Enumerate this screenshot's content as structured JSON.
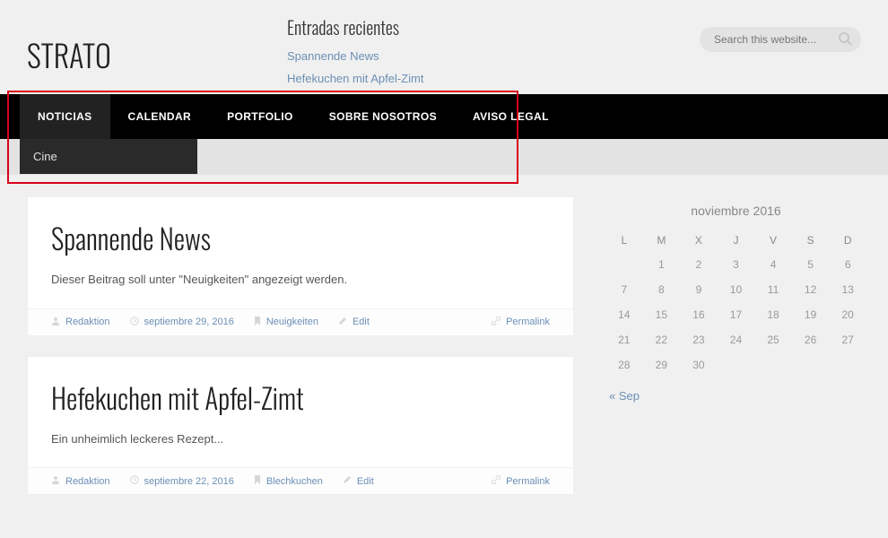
{
  "site": {
    "logo_text": "STRATO"
  },
  "search": {
    "placeholder": "Search this website..."
  },
  "recent_widget": {
    "title": "Entradas recientes",
    "items": [
      "Spannende News",
      "Hefekuchen mit Apfel-Zimt"
    ]
  },
  "nav": {
    "items": [
      {
        "label": "NOTICIAS",
        "active": true
      },
      {
        "label": "CALENDAR",
        "active": false
      },
      {
        "label": "PORTFOLIO",
        "active": false
      },
      {
        "label": "SOBRE NOSOTROS",
        "active": false
      },
      {
        "label": "AVISO LEGAL",
        "active": false
      }
    ],
    "submenu": [
      {
        "label": "Cine"
      }
    ]
  },
  "posts": [
    {
      "title": "Spannende News",
      "excerpt": "Dieser Beitrag soll unter \"Neuigkeiten\" angezeigt werden.",
      "author": "Redaktion",
      "date": "septiembre 29, 2016",
      "category": "Neuigkeiten",
      "edit_label": "Edit",
      "permalink_label": "Permalink"
    },
    {
      "title": "Hefekuchen mit Apfel-Zimt",
      "excerpt": "Ein unheimlich leckeres Rezept...",
      "author": "Redaktion",
      "date": "septiembre 22, 2016",
      "category": "Blechkuchen",
      "edit_label": "Edit",
      "permalink_label": "Permalink"
    }
  ],
  "calendar": {
    "caption": "noviembre 2016",
    "weekdays": [
      "L",
      "M",
      "X",
      "J",
      "V",
      "S",
      "D"
    ],
    "rows": [
      [
        "",
        "1",
        "2",
        "3",
        "4",
        "5",
        "6"
      ],
      [
        "7",
        "8",
        "9",
        "10",
        "11",
        "12",
        "13"
      ],
      [
        "14",
        "15",
        "16",
        "17",
        "18",
        "19",
        "20"
      ],
      [
        "21",
        "22",
        "23",
        "24",
        "25",
        "26",
        "27"
      ],
      [
        "28",
        "29",
        "30",
        "",
        "",
        "",
        ""
      ]
    ],
    "prev_link": "« Sep"
  }
}
